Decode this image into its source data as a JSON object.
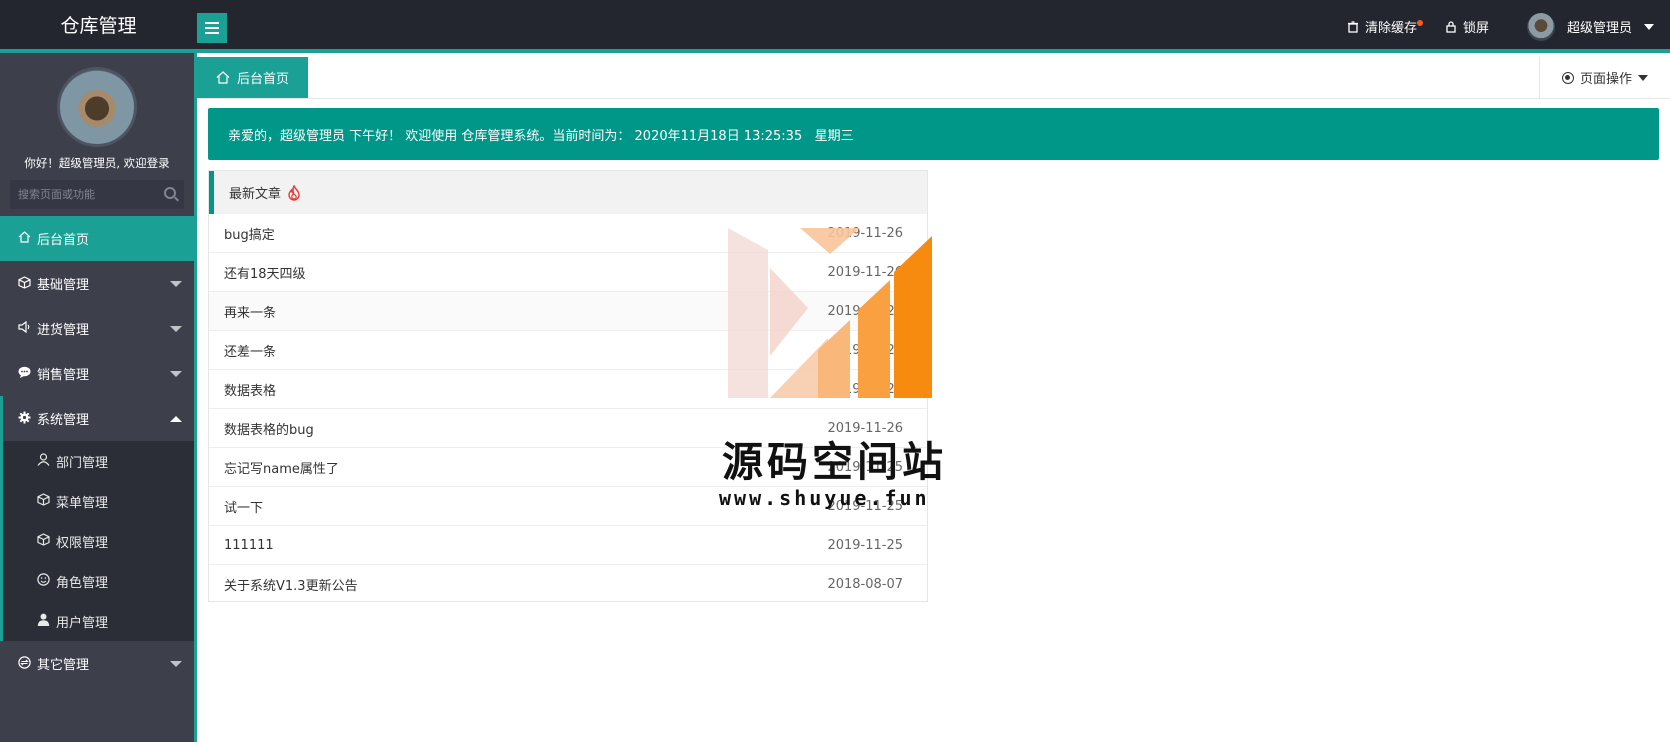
{
  "app": {
    "title": "仓库管理"
  },
  "topbar": {
    "clear_cache": "清除缓存",
    "lock_screen": "锁屏",
    "user_name": "超级管理员"
  },
  "sidebar": {
    "welcome": "你好！超级管理员, 欢迎登录",
    "search_placeholder": "搜索页面或功能",
    "items": [
      {
        "label": "后台首页",
        "icon": "home-icon"
      },
      {
        "label": "基础管理",
        "icon": "cube-icon"
      },
      {
        "label": "进货管理",
        "icon": "speaker-icon"
      },
      {
        "label": "销售管理",
        "icon": "chat-icon"
      },
      {
        "label": "系统管理",
        "icon": "gear-icon"
      },
      {
        "label": "其它管理",
        "icon": "exchange-icon"
      }
    ],
    "sub_items": [
      {
        "label": "部门管理",
        "icon": "user-icon"
      },
      {
        "label": "菜单管理",
        "icon": "cube-icon"
      },
      {
        "label": "权限管理",
        "icon": "cube-icon"
      },
      {
        "label": "角色管理",
        "icon": "smile-icon"
      },
      {
        "label": "用户管理",
        "icon": "person-icon"
      }
    ]
  },
  "tabs": {
    "home_label": "后台首页",
    "page_ops_label": "页面操作"
  },
  "banner": {
    "text": "亲爱的，超级管理员 下午好！ 欢迎使用 仓库管理系统。当前时间为： 2020年11月18日 13:25:35   星期三"
  },
  "articles": {
    "title": "最新文章",
    "rows": [
      {
        "title": "bug搞定",
        "date": "2019-11-26"
      },
      {
        "title": "还有18天四级",
        "date": "2019-11-26"
      },
      {
        "title": "再来一条",
        "date": "2019-11-26"
      },
      {
        "title": "还差一条",
        "date": "2019-11-26"
      },
      {
        "title": "数据表格",
        "date": "2019-11-26"
      },
      {
        "title": "数据表格的bug",
        "date": "2019-11-26"
      },
      {
        "title": "忘记写name属性了",
        "date": "2019-11-25"
      },
      {
        "title": "试一下",
        "date": "2019-11-25"
      },
      {
        "title": "111111",
        "date": "2019-11-25"
      },
      {
        "title": "关于系统V1.3更新公告",
        "date": "2018-08-07"
      }
    ]
  },
  "watermark": {
    "name": "源码空间站",
    "url": "www.shuyue.fun"
  },
  "colors": {
    "accent": "#1aa094",
    "banner": "#009688",
    "topbar": "#23262e",
    "sidebar": "#3d3f4b",
    "badge": "#ff5722"
  }
}
